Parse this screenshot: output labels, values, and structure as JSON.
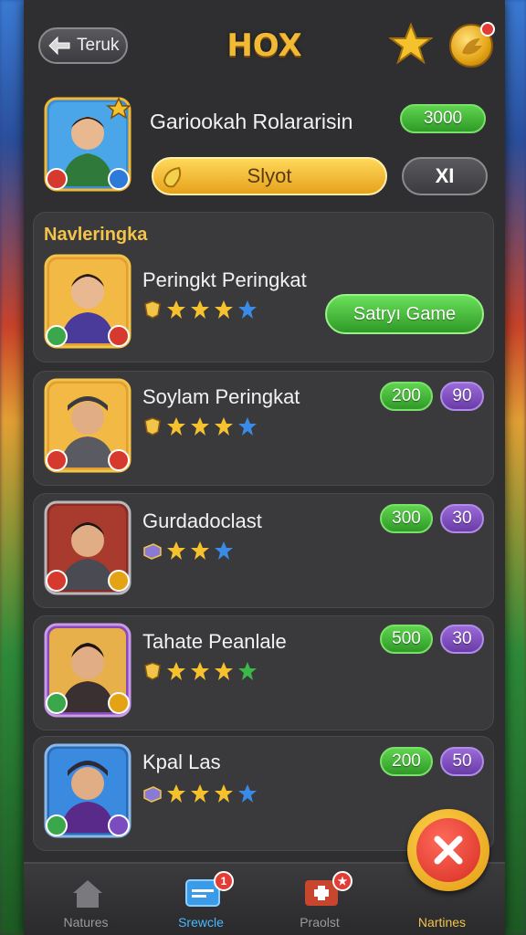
{
  "header": {
    "back_label": "Teruk",
    "title": "HOX"
  },
  "profile": {
    "name": "Gariookah Rolararisin",
    "score": "3000",
    "slot_label": "Slyot",
    "close_label": "XI"
  },
  "section": {
    "title": "Navleringka"
  },
  "featured": {
    "name": "Peringkt Peringkat",
    "stars": 3,
    "play_label": "Satryı Game"
  },
  "rows": [
    {
      "name": "Soylam Peringkat",
      "green_value": "200",
      "purple_value": "90",
      "stars": 3
    },
    {
      "name": "Gurdadoclast",
      "green_value": "300",
      "purple_value": "30",
      "stars": 2
    },
    {
      "name": "Tahate Peanlale",
      "green_value": "500",
      "purple_value": "30",
      "stars": 3
    },
    {
      "name": "Kpal Las",
      "green_value": "200",
      "purple_value": "50",
      "stars": 3
    }
  ],
  "bottom_nav": {
    "items": [
      {
        "label": "Natures",
        "color": "#9a9a9a"
      },
      {
        "label": "Srewcle",
        "color": "#4ab8ff",
        "badge": "1"
      },
      {
        "label": "Praolst",
        "color": "#9a9a9a",
        "badge": ""
      },
      {
        "label": "Nartines",
        "color": "#f2c44a"
      }
    ]
  },
  "colors": {
    "panel": "#2f2f31",
    "gold": "#f2b935",
    "green": "#3fb83a",
    "purple": "#7a4cc0"
  }
}
